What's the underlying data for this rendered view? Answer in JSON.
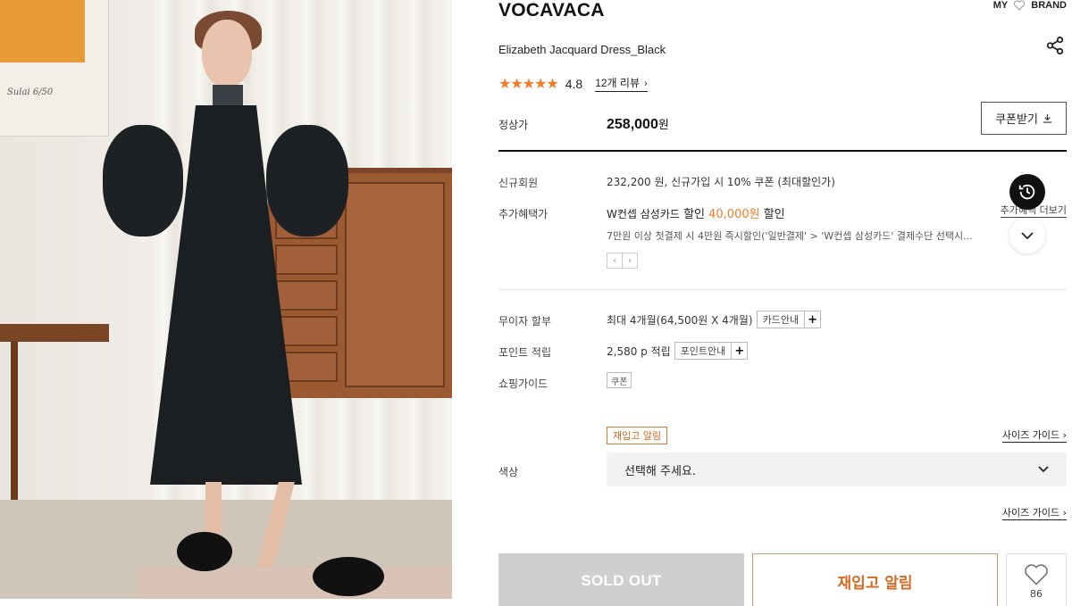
{
  "header": {
    "brand": "VOCAVACA",
    "my": "MY",
    "brand_link": "BRAND"
  },
  "product": {
    "name": "Elizabeth Jacquard Dress_Black",
    "stars": "★★★★★",
    "rating": "4.8",
    "review_link": "12개 리뷰",
    "price_label": "정상가",
    "price": "258,000",
    "price_unit": "원",
    "coupon_button": "쿠폰받기"
  },
  "benefits": {
    "new_member_label": "신규회원",
    "new_member_value": "232,200 원, 신규가입 시 10% 쿠폰 (최대할인가)",
    "extra_label": "추가혜택가",
    "extra_card": "W컨셉 삼성카드",
    "extra_discount_word": "할인",
    "extra_amount": "40,000원",
    "extra_discount_tail": "할인",
    "extra_desc": "7만원 이상 첫결제 시 4만원 즉시할인('일반결제' > 'W컨셉 삼성카드' 결제수단 선택시...",
    "more_link": "추가혜택 더보기"
  },
  "payment": {
    "installment_label": "무이자 할부",
    "installment_value": "최대 4개월(64,500원 X 4개월)",
    "card_guide": "카드안내",
    "point_label": "포인트 적립",
    "point_value": "2,580 p 적립",
    "point_guide": "포인트안내",
    "shopping_label": "쇼핑가이드",
    "coupon_tag": "쿠폰"
  },
  "options": {
    "restock_tag": "재입고 알림",
    "size_guide": "사이즈 가이드",
    "color_label": "색상",
    "color_placeholder": "선택해 주세요."
  },
  "actions": {
    "sold_out": "SOLD OUT",
    "restock": "재입고 알림",
    "likes": "86"
  },
  "colors": {
    "accent": "#f07c2a",
    "star": "#f07c2a"
  }
}
